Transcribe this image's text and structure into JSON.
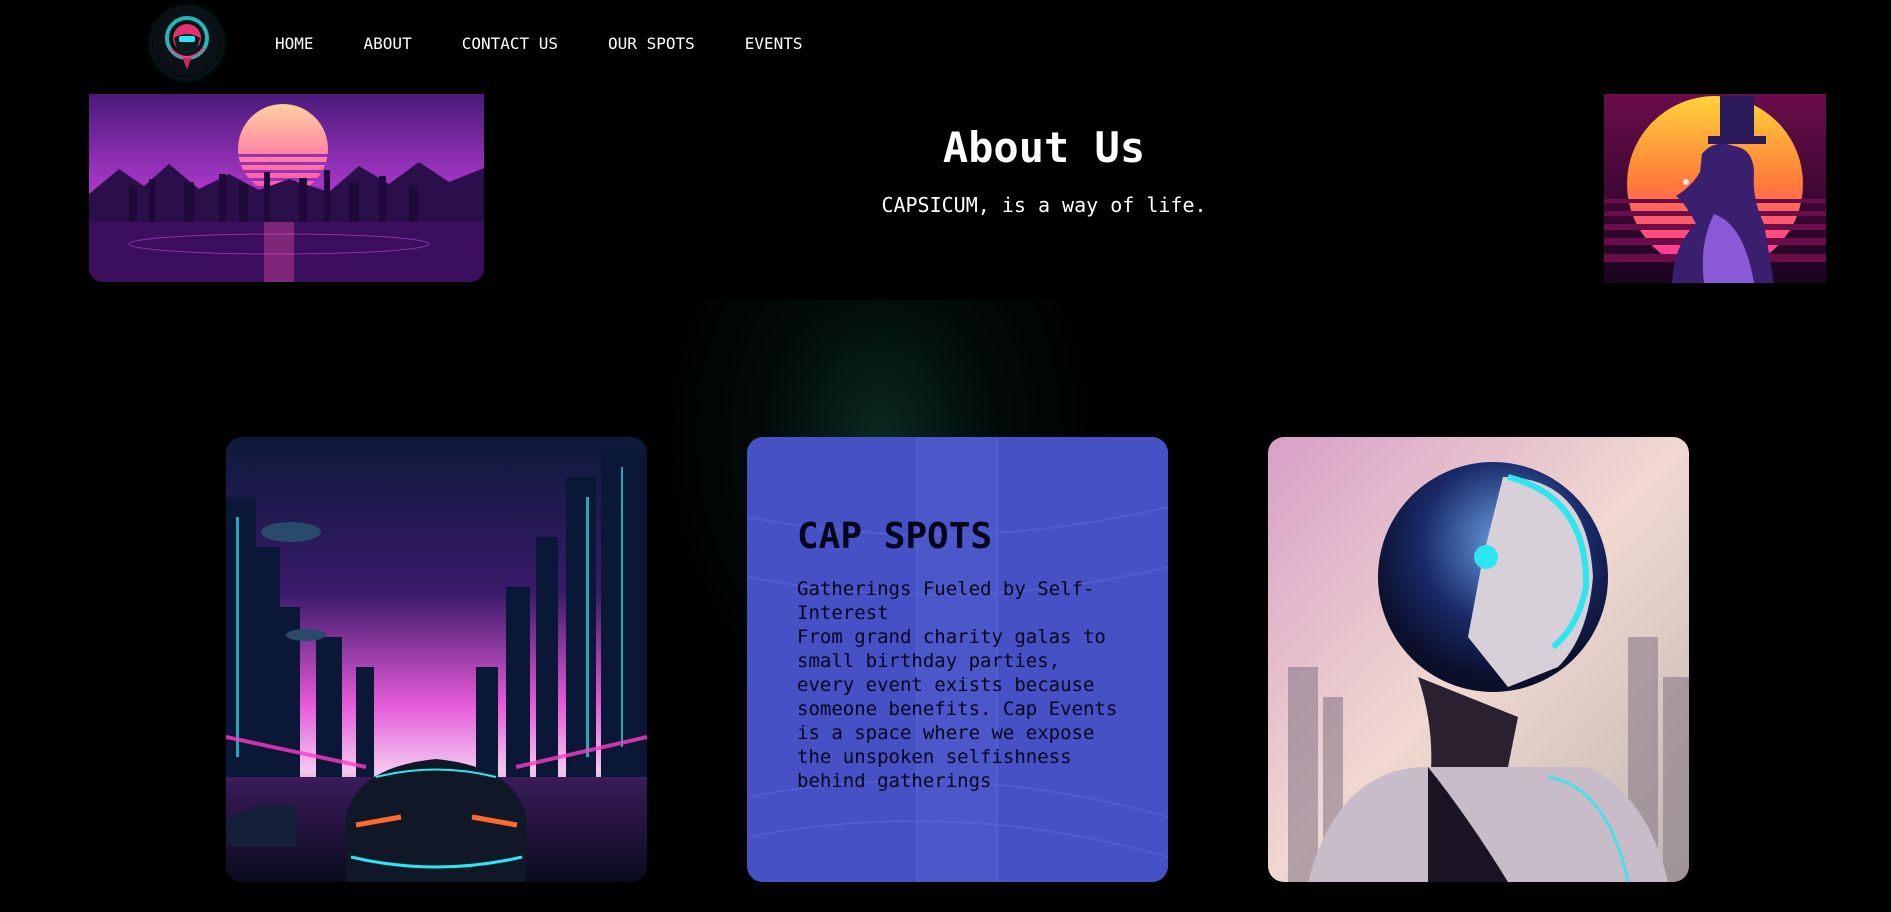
{
  "nav": {
    "logo_icon": "skull-logo-icon",
    "links": [
      {
        "label": "HOME"
      },
      {
        "label": "ABOUT"
      },
      {
        "label": "CONTACT US"
      },
      {
        "label": "OUR SPOTS"
      },
      {
        "label": "EVENTS"
      }
    ]
  },
  "hero": {
    "title": "About Us",
    "subtitle": "CAPSICUM, is a way of life."
  },
  "card": {
    "title": "CAP SPOTS",
    "heading_line": "Gatherings Fueled by Self-Interest",
    "body": "From grand charity galas to small birthday parties, every event exists because someone benefits. Cap Events is a space where we expose the unspoken selfishness behind gatherings"
  },
  "colors": {
    "background": "#000000",
    "card_accent": "#4551c4",
    "neon_pink": "#ff3ac8",
    "neon_cyan": "#2ee6f0"
  }
}
